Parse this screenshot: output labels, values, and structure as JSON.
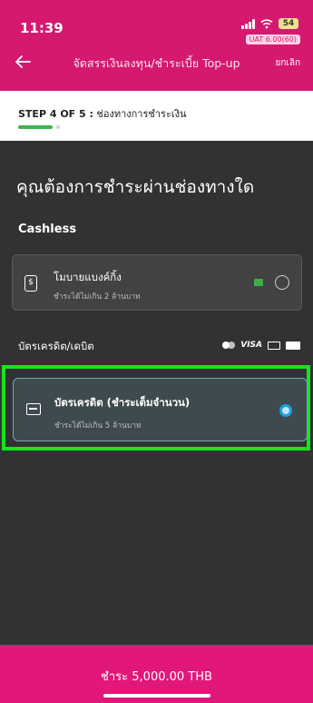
{
  "status_bar": {
    "time": "11:39",
    "battery": "54",
    "uat_badge": "UAT 6.00(60)"
  },
  "header": {
    "title": "จัดสรรเงินลงทุน/ชำระเบี้ย Top-up",
    "cancel_label": "ยกเลิก"
  },
  "step": {
    "label": "STEP 4 OF 5 :",
    "description": "ช่องทางการชำระเงิน",
    "current": 4,
    "total": 5
  },
  "main": {
    "question": "คุณต้องการชำระผ่านช่องทางใด",
    "cashless_section": "Cashless",
    "cashless_option": {
      "title": "โมบายแบงค์กิ้ง",
      "subtitle": "ชำระได้ไม่เกิน 2 ล้านบาท",
      "selected": false
    },
    "card_section": "บัตรเครดิต/เดบิต",
    "card_brands": [
      "mastercard-icon",
      "visa-icon",
      "jcb-icon",
      "amex-icon"
    ],
    "visa_text": "VISA",
    "credit_option": {
      "title": "บัตรเครดิต (ชำระเต็มจำนวน)",
      "subtitle": "ชำระได้ไม่เกิน 5 ล้านบาท",
      "selected": true
    }
  },
  "footer": {
    "pay_label": "ชำระ 5,000.00 THB"
  },
  "colors": {
    "brand": "#d4196f",
    "footer": "#e2177a",
    "highlight": "#13e61a",
    "progress": "#3fb54f",
    "selected_radio": "#17a2e6"
  }
}
